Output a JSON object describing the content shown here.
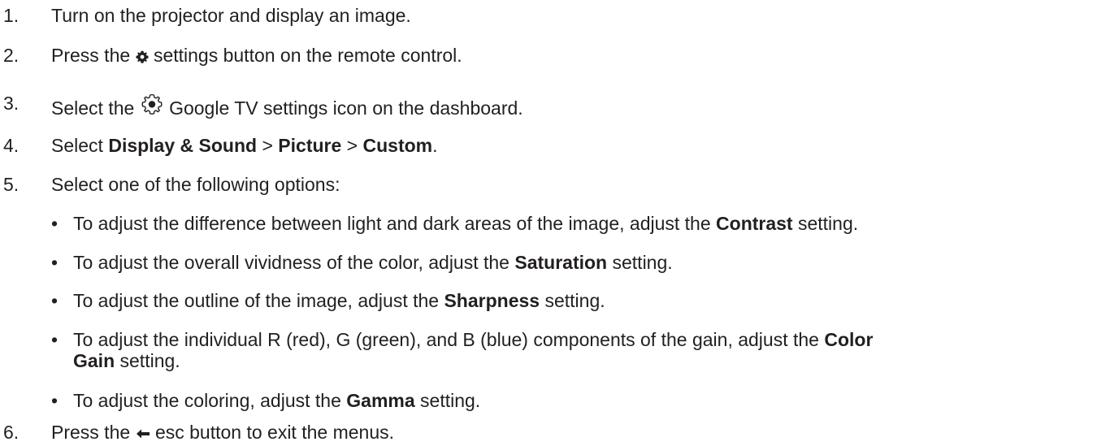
{
  "steps": [
    {
      "num": "1.",
      "parts": [
        "Turn on the projector and display an image."
      ]
    },
    {
      "num": "2.",
      "pre": "Press the",
      "icon": "gear-icon",
      "post": "settings button on the remote control."
    },
    {
      "num": "3.",
      "pre": "Select the",
      "icon": "google-tv-settings-icon",
      "post": "Google TV settings icon on the dashboard."
    },
    {
      "num": "4.",
      "pre": "Select",
      "b1": "Display & Sound",
      "sep1": ">",
      "b2": "Picture",
      "sep2": ">",
      "b3": "Custom",
      "end": "."
    },
    {
      "num": "5.",
      "text": "Select one of the following options:"
    },
    {
      "num": "6.",
      "pre": "Press the",
      "icon": "left-arrow-icon",
      "post": "esc button to exit the menus."
    }
  ],
  "options": [
    {
      "pre": "To adjust the difference between light and dark areas of the image, adjust the",
      "bold": "Contrast",
      "post": "setting."
    },
    {
      "pre": "To adjust the overall vividness of the color, adjust the",
      "bold": "Saturation",
      "post": "setting."
    },
    {
      "pre": "To adjust the outline of the image, adjust the",
      "bold": "Sharpness",
      "post": "setting."
    },
    {
      "pre": "To adjust the individual R (red), G (green), and B (blue) components of the gain, adjust the",
      "bold": "Color",
      "bold2": "Gain",
      "post": "setting."
    },
    {
      "pre": "To adjust the coloring, adjust the",
      "bold": "Gamma",
      "post": "setting."
    }
  ],
  "bullet": "•",
  "colors": {
    "text": "#231f20"
  }
}
